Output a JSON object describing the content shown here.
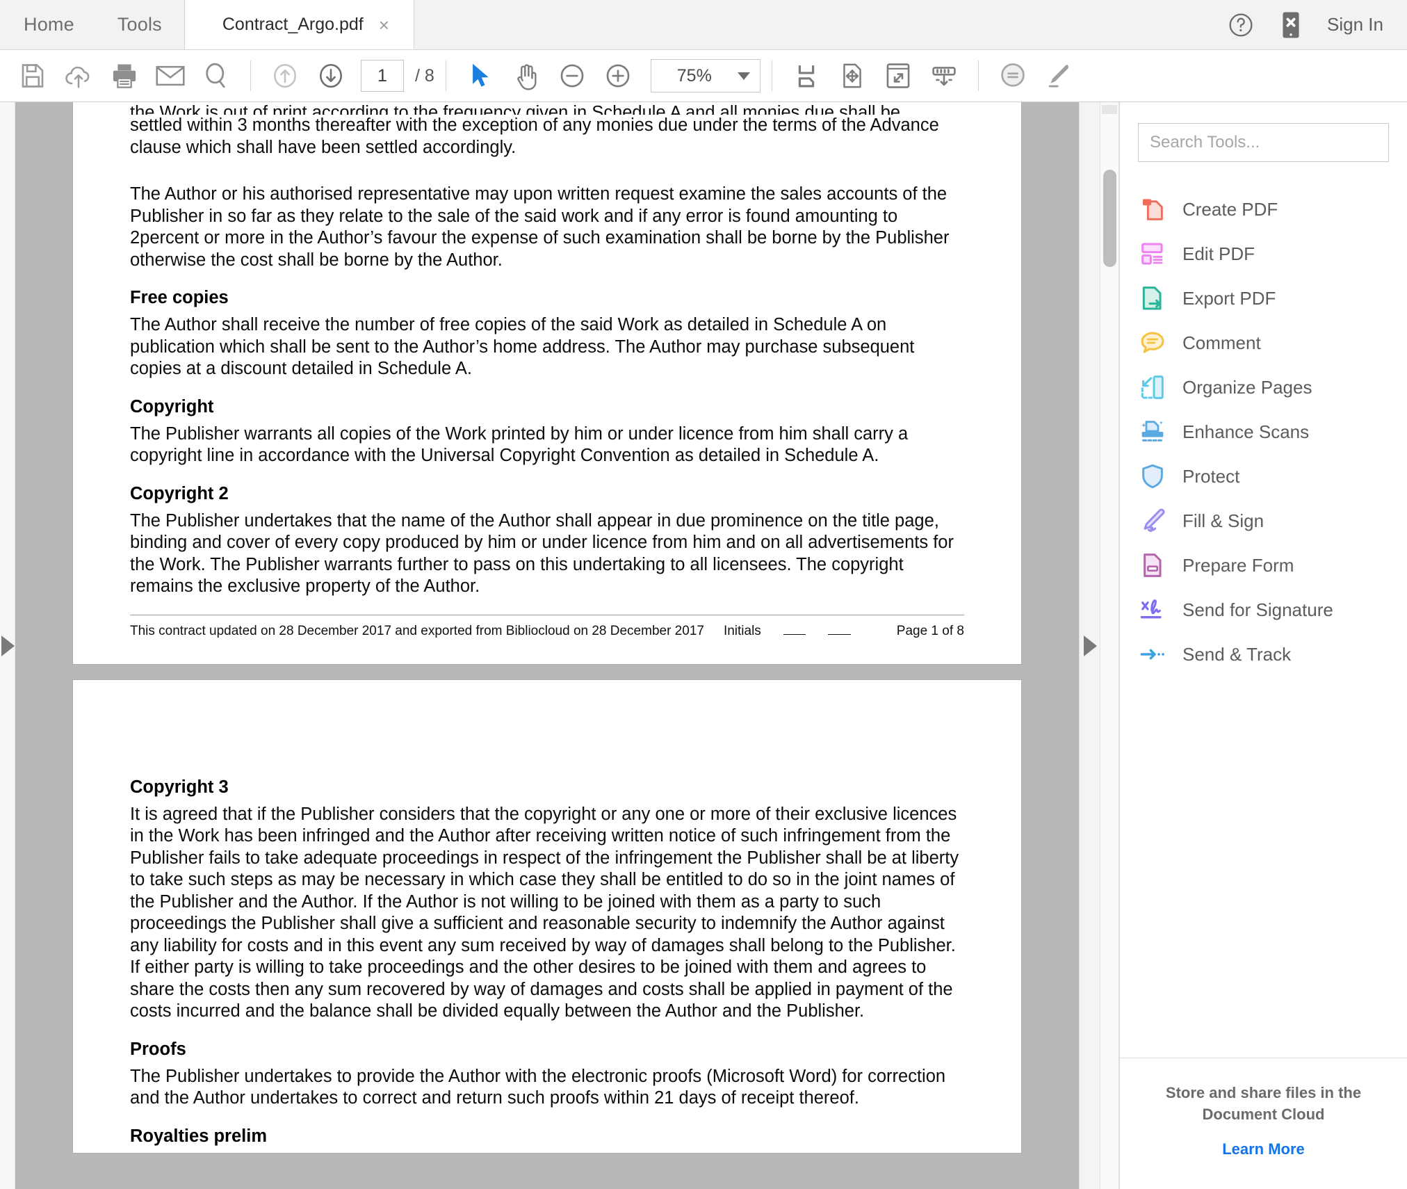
{
  "tabbar": {
    "menu": [
      {
        "label": "Home",
        "name": "menu-home"
      },
      {
        "label": "Tools",
        "name": "menu-tools"
      }
    ],
    "document_tab": {
      "title": "Contract_Argo.pdf",
      "close_label": "×"
    },
    "help_icon": "help-circle-icon",
    "mobile_link_icon": "mobile-device-icon",
    "sign_in_label": "Sign In"
  },
  "toolbar": {
    "icons_left": [
      {
        "name": "save-icon",
        "label": "Save"
      },
      {
        "name": "cloud-upload-icon",
        "label": "Save to Cloud"
      },
      {
        "name": "print-icon",
        "label": "Print"
      },
      {
        "name": "email-icon",
        "label": "Email"
      },
      {
        "name": "search-icon",
        "label": "Find"
      }
    ],
    "page_up_icon": "page-up-arrow-icon",
    "page_down_icon": "page-down-arrow-icon",
    "page_number": "1",
    "page_total": "/ 8",
    "select_tool_icon": "cursor-select-icon",
    "hand_tool_icon": "hand-pan-icon",
    "zoom_out_icon": "zoom-out-icon",
    "zoom_in_icon": "zoom-in-icon",
    "zoom_level": "75%",
    "icons_right": [
      {
        "name": "fit-page-icon",
        "label": "Fit Page"
      },
      {
        "name": "rotate-pan-page-icon",
        "label": "Page Controls"
      },
      {
        "name": "fullscreen-icon",
        "label": "Full Screen"
      },
      {
        "name": "scroll-mode-icon",
        "label": "Scroll Mode"
      }
    ],
    "comment_icon": "comment-bubble-icon",
    "highlight_icon": "highlighter-pen-icon"
  },
  "viewer": {
    "left_panel_arrow": "expand-left-panel-arrow",
    "right_panel_arrow": "expand-right-panel-arrow",
    "scrollbar": "vertical-scrollbar"
  },
  "document": {
    "page1": {
      "clipped_line": "the Work is out of print according to the frequency given in Schedule A and all monies due shall be delivered and",
      "para_accounting": "settled within 3 months thereafter with the exception of any monies due under the terms of the Advance clause which shall have been settled accordingly.",
      "para_audit": "The Author or his authorised representative may upon written request examine the sales accounts of the Publisher in so far as they relate to the sale of the said work and if any error is found amounting to 2percent or more in the Author’s favour the expense of such examination shall be borne by the Publisher otherwise the cost shall be borne by the Author.",
      "free_copies_heading": "Free copies",
      "free_copies_body": "The Author shall receive the number of free copies of the said Work as detailed in Schedule A on publication which shall be sent to the Author’s home address. The Author may purchase subsequent copies at a discount detailed in Schedule A.",
      "copyright_heading": "Copyright",
      "copyright_body": "The Publisher warrants all copies of the Work printed by him or under licence from him shall carry a copyright line in accordance with the Universal Copyright Convention as detailed in Schedule A.",
      "copyright2_heading": "Copyright 2",
      "copyright2_body": "The Publisher undertakes that the name of the Author shall appear in due prominence on the title page, binding and cover of every copy produced by him or under licence from him and on all advertisements for the Work. The Publisher warrants further to pass on this undertaking to all licensees.  The copyright remains the exclusive property of the Author.",
      "footer_text": "This contract updated on 28 December 2017 and exported from Bibliocloud on 28 December 2017",
      "footer_initials": "Initials",
      "footer_page": "Page 1 of 8"
    },
    "page2": {
      "copyright3_heading": "Copyright 3",
      "copyright3_body": "It is agreed that if the Publisher considers that the copyright or any one or more of their exclusive licences in the Work has been infringed and the Author after receiving written notice of such infringement from the Publisher fails to take adequate proceedings in respect of the infringement the Publisher shall be at liberty to take such steps as may be necessary in which case they shall be entitled to do so in the joint names of the Publisher and the Author. If the Author is not willing to be joined with them as a party to such proceedings the Publisher shall give a sufficient and reasonable security to indemnify the Author against any liability for costs and in this event any sum received by way of damages shall belong to the Publisher. If either party is willing to take proceedings and the other desires to be joined with them and agrees to share the costs then any sum recovered by way of damages and costs shall be applied in payment of the costs incurred and the balance shall be divided equally between the Author and the Publisher.",
      "proofs_heading": "Proofs",
      "proofs_body": "The Publisher undertakes to provide the Author with the electronic proofs (Microsoft Word) for correction and the Author undertakes to correct and return such proofs within 21 days of receipt thereof.",
      "royalties_heading": "Royalties prelim"
    }
  },
  "tools_panel": {
    "search_placeholder": "Search Tools...",
    "items": [
      {
        "label": "Create PDF",
        "icon": "create-pdf-icon",
        "color": "#ee6c5a"
      },
      {
        "label": "Edit PDF",
        "icon": "edit-pdf-icon",
        "color": "#ee82ee"
      },
      {
        "label": "Export PDF",
        "icon": "export-pdf-icon",
        "color": "#2bb598"
      },
      {
        "label": "Comment",
        "icon": "comment-icon",
        "color": "#f5c242"
      },
      {
        "label": "Organize Pages",
        "icon": "organize-pages-icon",
        "color": "#5ec9ea"
      },
      {
        "label": "Enhance Scans",
        "icon": "enhance-scans-icon",
        "color": "#5aa9e0"
      },
      {
        "label": "Protect",
        "icon": "protect-shield-icon",
        "color": "#5aa9e0"
      },
      {
        "label": "Fill & Sign",
        "icon": "fill-and-sign-icon",
        "color": "#9a8ef0"
      },
      {
        "label": "Prepare Form",
        "icon": "prepare-form-icon",
        "color": "#b664ad"
      },
      {
        "label": "Send for Signature",
        "icon": "send-for-signature-icon",
        "color": "#7b6ef0"
      },
      {
        "label": "Send & Track",
        "icon": "send-and-track-icon",
        "color": "#3aa3e0"
      }
    ],
    "footer_line1": "Store and share files in the",
    "footer_line2": "Document Cloud",
    "footer_link": "Learn More"
  }
}
